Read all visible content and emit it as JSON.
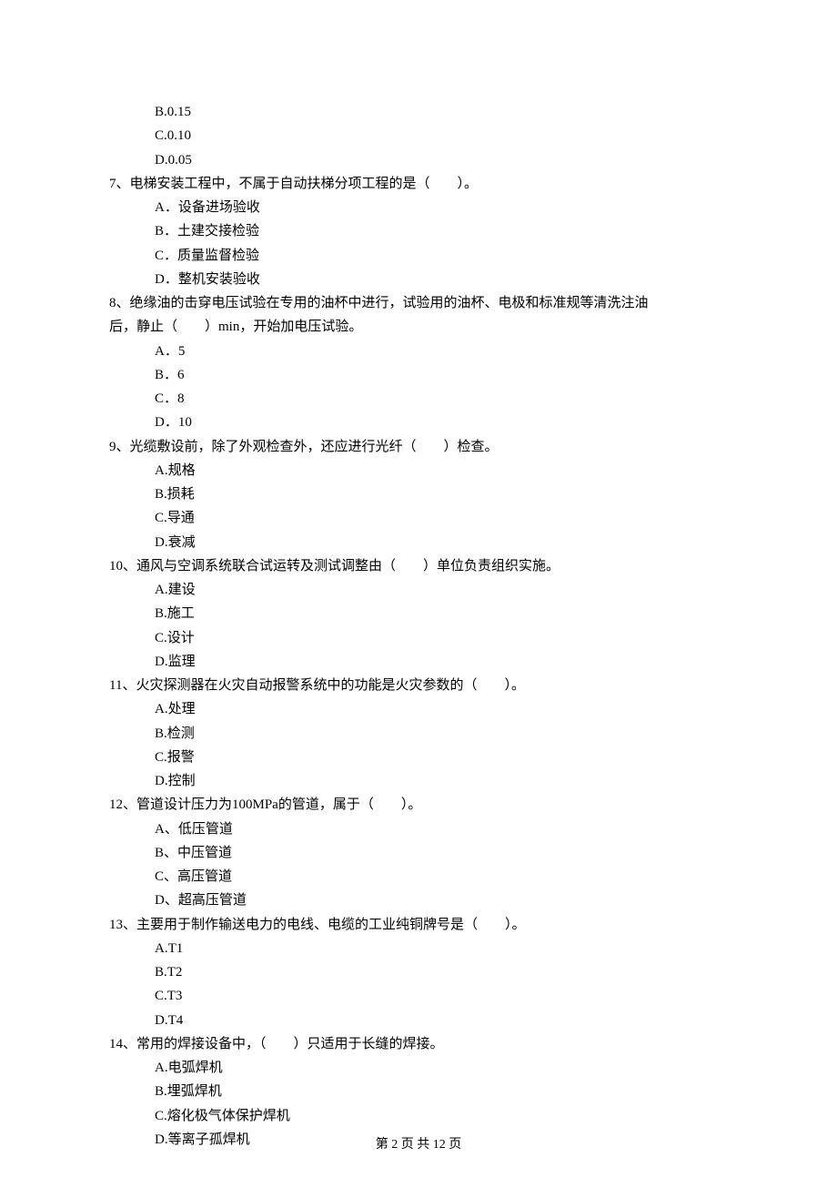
{
  "q6_options": {
    "b": "B.0.15",
    "c": "C.0.10",
    "d": "D.0.05"
  },
  "q7": {
    "stem": "7、电梯安装工程中，不属于自动扶梯分项工程的是（　　）。",
    "a": "A．设备进场验收",
    "b": "B．土建交接检验",
    "c": "C．质量监督检验",
    "d": "D．整机安装验收"
  },
  "q8": {
    "stem_line1": "8、绝缘油的击穿电压试验在专用的油杯中进行，试验用的油杯、电极和标准规等清洗注油",
    "stem_line2": "后，静止（　　）min，开始加电压试验。",
    "a": "A．5",
    "b": "B．6",
    "c": "C．8",
    "d": "D．10"
  },
  "q9": {
    "stem": "9、光缆敷设前，除了外观检查外，还应进行光纤（　　）检查。",
    "a": "A.规格",
    "b": "B.损耗",
    "c": "C.导通",
    "d": "D.衰减"
  },
  "q10": {
    "stem": "10、通风与空调系统联合试运转及测试调整由（　　）单位负责组织实施。",
    "a": "A.建设",
    "b": "B.施工",
    "c": "C.设计",
    "d": "D.监理"
  },
  "q11": {
    "stem": "11、火灾探测器在火灾自动报警系统中的功能是火灾参数的（　　）。",
    "a": "A.处理",
    "b": "B.检测",
    "c": "C.报警",
    "d": "D.控制"
  },
  "q12": {
    "stem": "12、管道设计压力为100MPa的管道，属于（　　）。",
    "a": "A、低压管道",
    "b": "B、中压管道",
    "c": "C、高压管道",
    "d": "D、超高压管道"
  },
  "q13": {
    "stem": "13、主要用于制作输送电力的电线、电缆的工业纯铜牌号是（　　）。",
    "a": "A.T1",
    "b": "B.T2",
    "c": "C.T3",
    "d": "D.T4"
  },
  "q14": {
    "stem": "14、常用的焊接设备中，（　　）只适用于长缝的焊接。",
    "a": "A.电弧焊机",
    "b": "B.埋弧焊机",
    "c": "C.熔化极气体保护焊机",
    "d": "D.等离子孤焊机"
  },
  "footer": "第 2 页 共 12 页"
}
